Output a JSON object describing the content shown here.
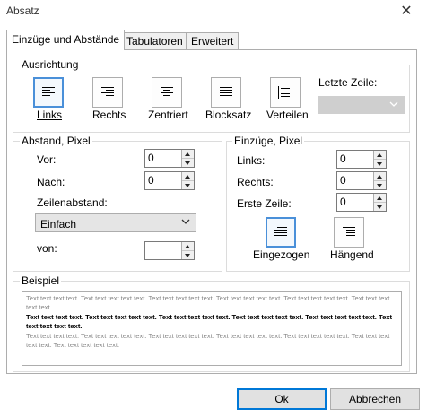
{
  "window": {
    "title": "Absatz"
  },
  "tabs": [
    "Einzüge und Abstände",
    "Tabulatoren",
    "Erweitert"
  ],
  "alignment": {
    "label": "Ausrichtung",
    "options": [
      {
        "label": "Links",
        "selected": true
      },
      {
        "label": "Rechts",
        "selected": false
      },
      {
        "label": "Zentriert",
        "selected": false
      },
      {
        "label": "Blocksatz",
        "selected": false
      },
      {
        "label": "Verteilen",
        "selected": false
      }
    ],
    "last_line_label": "Letzte Zeile:",
    "last_line_value": ""
  },
  "spacing": {
    "label": "Abstand, Pixel",
    "before_label": "Vor:",
    "before_value": "0",
    "after_label": "Nach:",
    "after_value": "0",
    "line_spacing_label": "Zeilenabstand:",
    "line_spacing_value": "Einfach",
    "of_label": "von:",
    "of_value": ""
  },
  "indents": {
    "label": "Einzüge, Pixel",
    "left_label": "Links:",
    "left_value": "0",
    "right_label": "Rechts:",
    "right_value": "0",
    "first_line_label": "Erste Zeile:",
    "first_line_value": "0",
    "indented_label": "Eingezogen",
    "hanging_label": "Hängend"
  },
  "preview": {
    "label": "Beispiel",
    "text_before": "Text text text text. Text text text text text. Text text text text text. Text text text text text. Text text text text text. Text text text text text.",
    "text_current": "Text text text text. Text text text text text. Text text text text text. Text text text text text. Text text text text text. Text text text text text.",
    "text_after": "Text text text text. Text text text text text. Text text text text text. Text text text text text. Text text text text text. Text text text text text. Text text text text text."
  },
  "buttons": {
    "ok": "Ok",
    "cancel": "Abbrechen"
  }
}
